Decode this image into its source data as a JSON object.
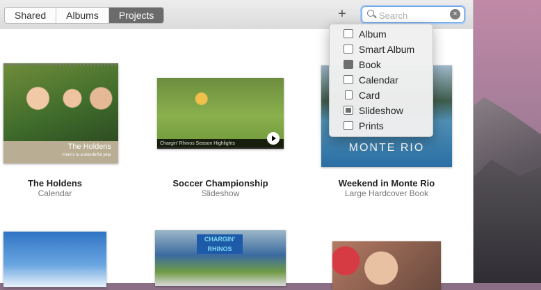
{
  "toolbar": {
    "tabs": [
      {
        "label": "Shared",
        "active": false
      },
      {
        "label": "Albums",
        "active": false
      },
      {
        "label": "Projects",
        "active": true
      }
    ],
    "add_label": "+",
    "search": {
      "placeholder": "Search",
      "value": "",
      "icon": "search-icon",
      "clear_icon": "clear-icon"
    }
  },
  "menu": {
    "items": [
      {
        "label": "Album",
        "icon": "album-icon"
      },
      {
        "label": "Smart Album",
        "icon": "smart-album-icon"
      },
      {
        "label": "Book",
        "icon": "book-icon"
      },
      {
        "label": "Calendar",
        "icon": "calendar-icon"
      },
      {
        "label": "Card",
        "icon": "card-icon"
      },
      {
        "label": "Slideshow",
        "icon": "slideshow-icon"
      },
      {
        "label": "Prints",
        "icon": "prints-icon"
      }
    ]
  },
  "projects": [
    {
      "title": "The Holdens",
      "subtitle": "Calendar",
      "cover_title": "The Holdens",
      "cover_caption": "Here's to a wonderful year"
    },
    {
      "title": "Soccer Championship",
      "subtitle": "Slideshow",
      "caption": "Chargin' Rhinos Season Highlights"
    },
    {
      "title": "Weekend in Monte Rio",
      "subtitle": "Large Hardcover Book",
      "cover_title": "MONTE RIO"
    },
    {
      "title": "",
      "subtitle": ""
    },
    {
      "title": "",
      "subtitle": "",
      "banner": "CHARGIN' RHINOS"
    },
    {
      "title": "",
      "subtitle": ""
    }
  ],
  "colors": {
    "active_tab": "#6b6b6b",
    "focus_ring": "#6aa3e6"
  }
}
